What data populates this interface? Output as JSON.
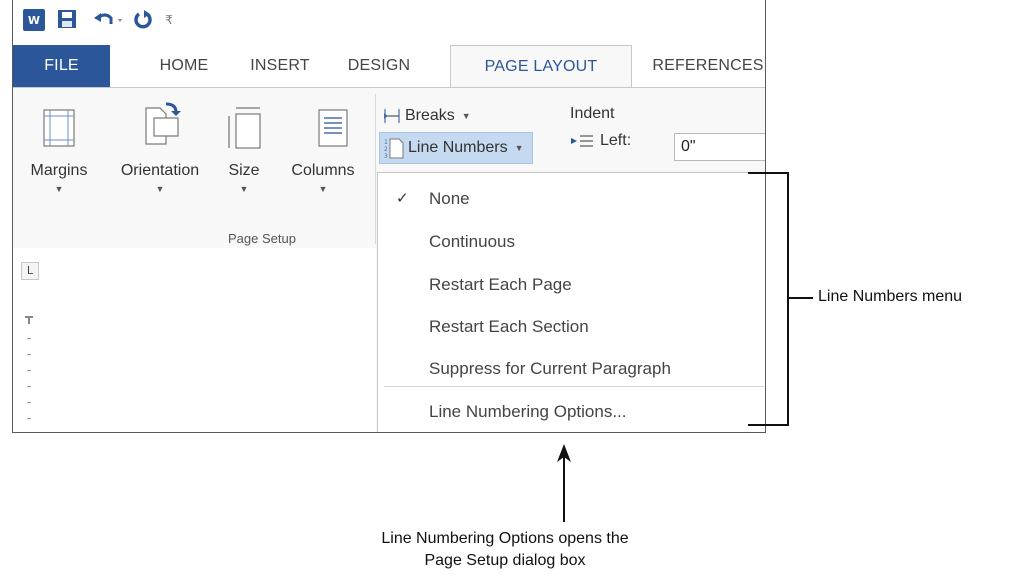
{
  "quick_access": {
    "logo_text": "W",
    "icons": [
      "word-logo-icon",
      "save-icon",
      "undo-icon",
      "redo-icon",
      "customize-qat-icon"
    ],
    "customize_glyph": "₹"
  },
  "tabs": [
    {
      "label": "FILE"
    },
    {
      "label": "HOME"
    },
    {
      "label": "INSERT"
    },
    {
      "label": "DESIGN"
    },
    {
      "label": "PAGE LAYOUT"
    },
    {
      "label": "REFERENCES"
    }
  ],
  "ribbon": {
    "margins_label": "Margins",
    "orientation_label": "Orientation",
    "size_label": "Size",
    "columns_label": "Columns",
    "group_label": "Page Setup",
    "breaks_label": "Breaks",
    "line_numbers_label": "Line Numbers",
    "indent_title": "Indent",
    "indent_left_label": "Left:",
    "indent_left_value": "0\""
  },
  "menu": {
    "checked_index": 0,
    "items": [
      {
        "label": "None"
      },
      {
        "label": "Continuous"
      },
      {
        "label": "Restart Each Page"
      },
      {
        "label": "Restart Each Section"
      },
      {
        "label": "Suppress for Current Paragraph"
      },
      {
        "label": "Line Numbering Options..."
      }
    ]
  },
  "annotations": {
    "line_numbers_menu": "Line Numbers menu",
    "options_line1": "Line Numbering Options opens the",
    "options_line2": "Page Setup dialog box"
  },
  "colors": {
    "accent": "#2b579a",
    "selected_button": "#c5d9f1"
  }
}
